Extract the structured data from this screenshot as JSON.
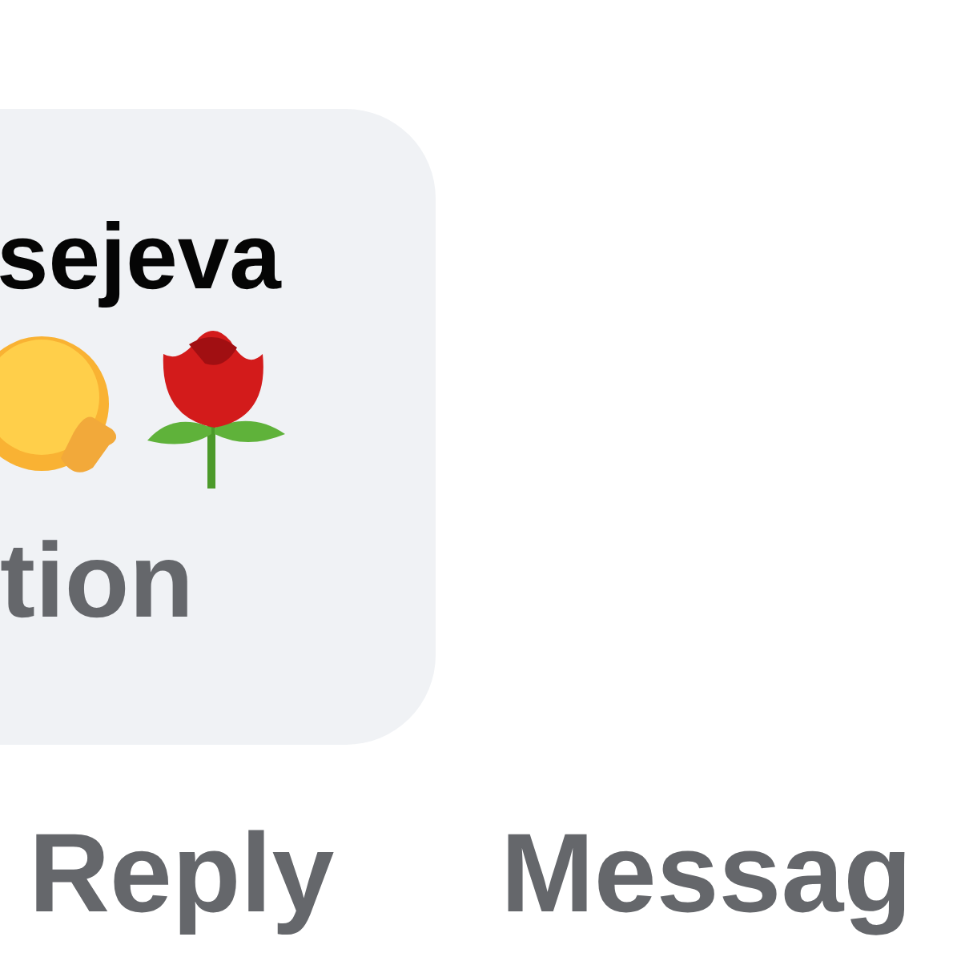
{
  "comment": {
    "author": "sejeva",
    "text_fragment": "tion"
  },
  "actions": [
    {
      "label": "Reply"
    },
    {
      "label": "Messag"
    }
  ]
}
